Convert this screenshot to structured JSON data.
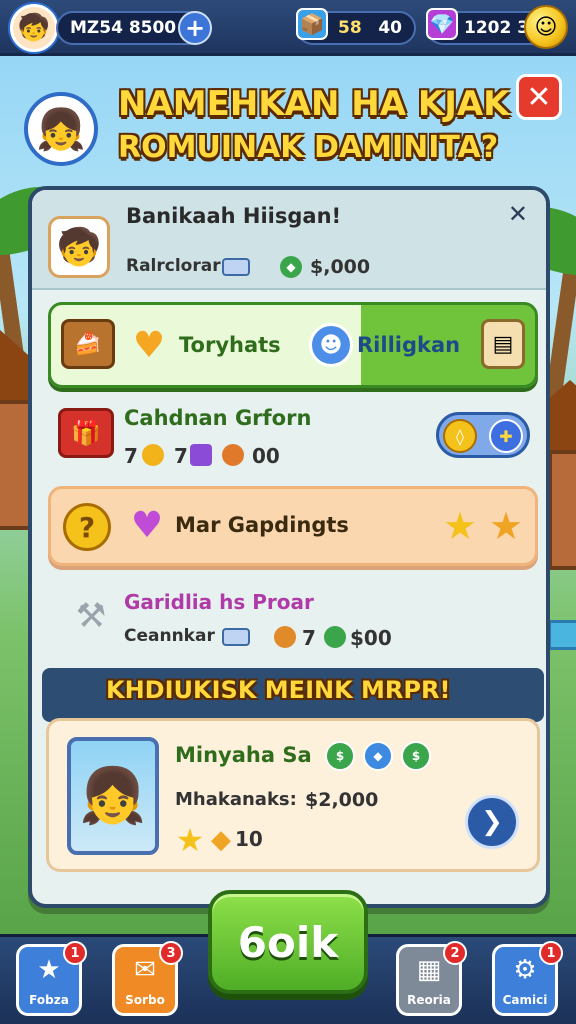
{
  "top_bar": {
    "player_name": "MZ54 8500",
    "resource_1_value": "58",
    "resource_2_value": "40",
    "gems_value": "1202 3"
  },
  "header": {
    "title_line1": "NAMEHKAN HA KJAK",
    "title_line2": "ROMUINAK DAMINITA?"
  },
  "panel": {
    "heading": "Banikaah Hiisgan!",
    "reward_label": "Ralrclorar",
    "reward_value": "$,000",
    "row1_left": "Toryhats",
    "row1_right": "Rilligkan",
    "row2_title": "Cahdnan Grforn",
    "row2_stats": [
      "7",
      "7",
      "00"
    ],
    "row3_title": "Mar Gapdingts",
    "row4_title": "Garidlia hs Proar",
    "row4_label": "Ceannkar",
    "row4_stats": [
      "7",
      "$00"
    ],
    "section_title": "KHDIUKISK MEINK MRPR!",
    "card": {
      "name": "Minyaha Sa",
      "sub_label": "Mhakanaks:",
      "sub_value": "$2,000",
      "stars_value": "10"
    }
  },
  "main_button": {
    "label": "6oik"
  },
  "bottom_nav": [
    {
      "label": "Fobza",
      "badge": "1",
      "color": "#3d7fd9",
      "icon": "star-icon"
    },
    {
      "label": "Sorbo",
      "badge": "3",
      "color": "#f08a24",
      "icon": "mail-icon"
    },
    {
      "label": "Reoria",
      "badge": "2",
      "color": "#7f8a99",
      "icon": "chest-icon"
    },
    {
      "label": "Camici",
      "badge": "1",
      "color": "#3d7fd9",
      "icon": "gear-icon"
    }
  ]
}
